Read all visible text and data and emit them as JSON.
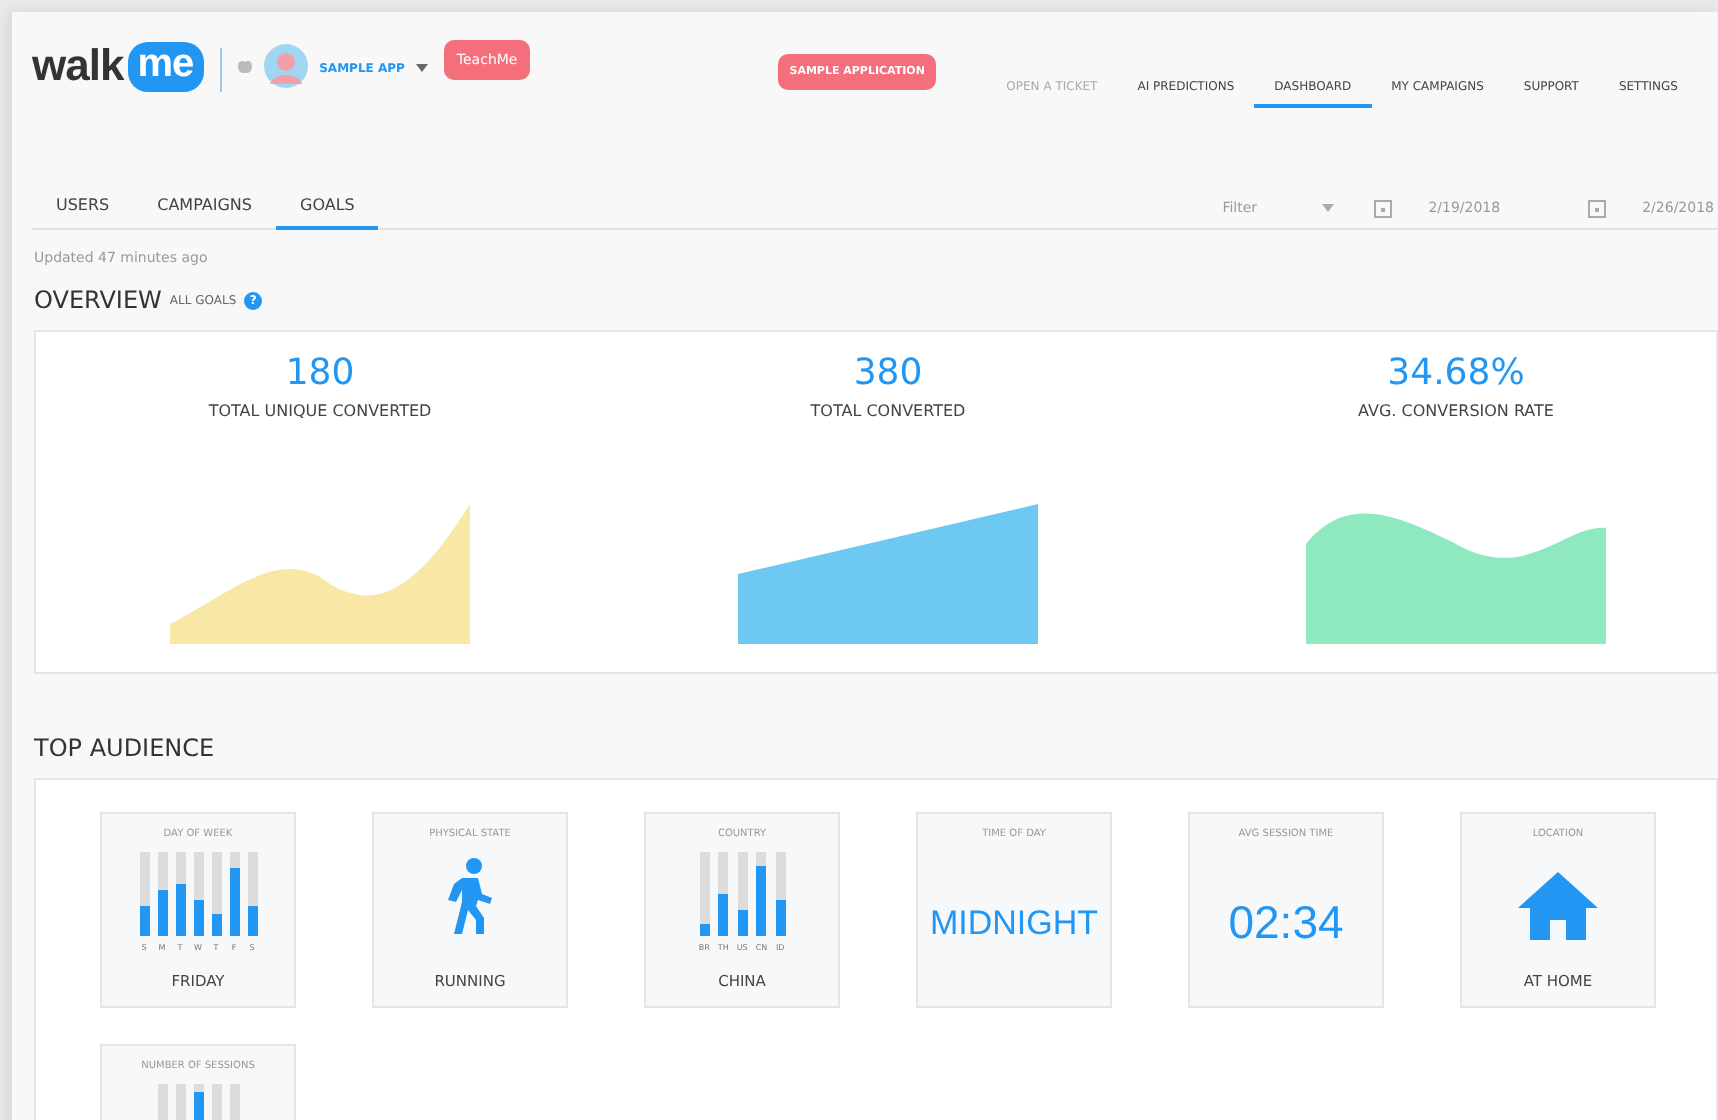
{
  "header": {
    "logo": "walk",
    "logo_bubble": "me",
    "app_name": "SAMPLE APP",
    "teachme": "TeachMe",
    "badge": "SAMPLE APPLICATION",
    "nav": [
      {
        "label": "OPEN A TICKET",
        "kind": "muted",
        "selected": false
      },
      {
        "label": "AI PREDICTIONS",
        "kind": "link",
        "selected": false
      },
      {
        "label": "DASHBOARD",
        "kind": "link",
        "selected": true
      },
      {
        "label": "MY CAMPAIGNS",
        "kind": "link",
        "selected": false
      },
      {
        "label": "SUPPORT",
        "kind": "link",
        "selected": false
      },
      {
        "label": "SETTINGS",
        "kind": "link",
        "selected": false
      }
    ]
  },
  "tabs": [
    {
      "label": "USERS",
      "selected": false
    },
    {
      "label": "CAMPAIGNS",
      "selected": false
    },
    {
      "label": "GOALS",
      "selected": true
    }
  ],
  "filter": {
    "placeholder": "Filter",
    "start_date": "2/19/2018",
    "end_date": "2/26/2018"
  },
  "updated": "Updated 47 minutes ago",
  "overview": {
    "title": "OVERVIEW",
    "subtitle": "ALL GOALS",
    "help": "?",
    "metrics": [
      {
        "value": "180",
        "label": "TOTAL UNIQUE CONVERTED",
        "kind": "wave",
        "color": "#f9e7a6"
      },
      {
        "value": "380",
        "label": "TOTAL CONVERTED",
        "kind": "ramp",
        "color": "#6dc8f2"
      },
      {
        "value": "34.68%",
        "label": "AVG. CONVERSION RATE",
        "kind": "hill",
        "color": "#8ee8c0"
      }
    ]
  },
  "audience": {
    "title": "TOP AUDIENCE",
    "tiles": [
      {
        "kind": "bars",
        "title": "DAY OF WEEK",
        "value": "FRIDAY",
        "bars": [
          {
            "label": "S",
            "level": 0.35
          },
          {
            "label": "M",
            "level": 0.54
          },
          {
            "label": "T",
            "level": 0.63
          },
          {
            "label": "W",
            "level": 0.44
          },
          {
            "label": "T",
            "level": 0.27
          },
          {
            "label": "F",
            "level": 0.82
          },
          {
            "label": "S",
            "level": 0.35
          }
        ]
      },
      {
        "kind": "walker",
        "title": "PHYSICAL STATE",
        "value": "RUNNING"
      },
      {
        "kind": "bars",
        "title": "COUNTRY",
        "value": "CHINA",
        "bars": [
          {
            "label": "BR",
            "level": 0.15
          },
          {
            "label": "TH",
            "level": 0.49
          },
          {
            "label": "US",
            "level": 0.32
          },
          {
            "label": "CN",
            "level": 0.83
          },
          {
            "label": "ID",
            "level": 0.43
          }
        ]
      },
      {
        "kind": "big",
        "title": "TIME OF DAY",
        "value": "MIDNIGHT"
      },
      {
        "kind": "big",
        "title": "AVG SESSION TIME",
        "value": "02:34"
      },
      {
        "kind": "house",
        "title": "LOCATION",
        "value": "AT HOME"
      },
      {
        "kind": "bars",
        "title": "NUMBER OF SESSIONS",
        "bars": [
          {
            "highlighted": false
          },
          {
            "highlighted": false
          },
          {
            "highlighted": true
          },
          {
            "highlighted": false
          },
          {
            "highlighted": false
          }
        ]
      }
    ]
  }
}
